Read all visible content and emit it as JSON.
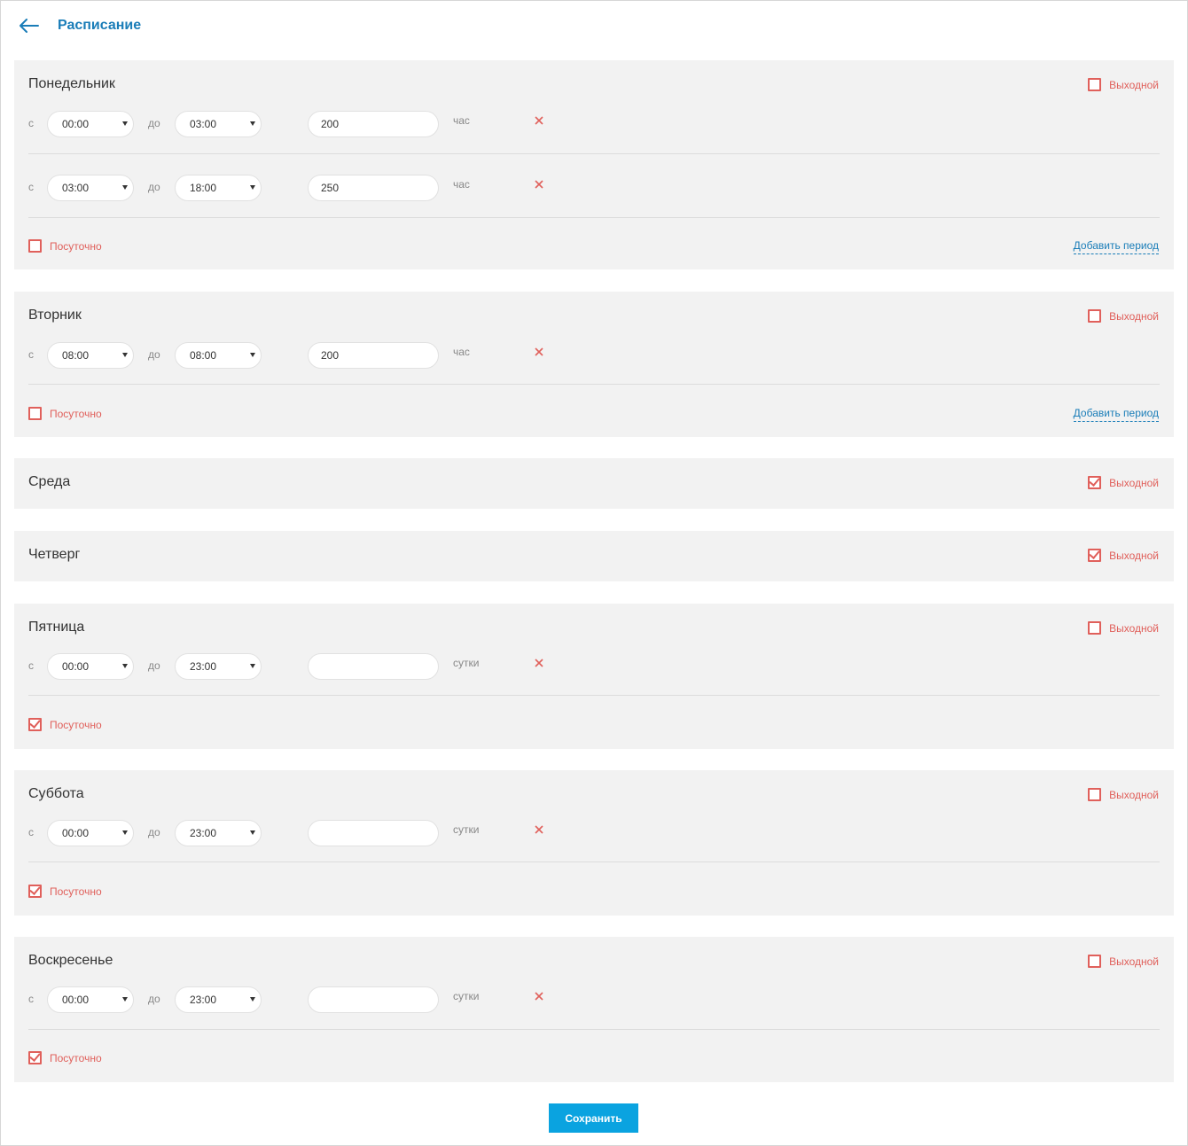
{
  "header": {
    "title": "Расписание"
  },
  "labels": {
    "from": "с",
    "to": "до",
    "day_off": "Выходной",
    "daily": "Посуточно",
    "add_period": "Добавить период",
    "save": "Сохранить"
  },
  "colors": {
    "accent_blue": "#1a7db8",
    "checkbox_red": "#e0605b",
    "button_blue": "#0aa3e0",
    "panel_bg": "#f2f2f2"
  },
  "days": [
    {
      "name": "Понедельник",
      "day_off": false,
      "daily": false,
      "periods": [
        {
          "from": "00:00",
          "to": "03:00",
          "price": "200",
          "unit": "час"
        },
        {
          "from": "03:00",
          "to": "18:00",
          "price": "250",
          "unit": "час"
        }
      ]
    },
    {
      "name": "Вторник",
      "day_off": false,
      "daily": false,
      "periods": [
        {
          "from": "08:00",
          "to": "08:00",
          "price": "200",
          "unit": "час"
        }
      ]
    },
    {
      "name": "Среда",
      "day_off": true,
      "periods": []
    },
    {
      "name": "Четверг",
      "day_off": true,
      "periods": []
    },
    {
      "name": "Пятница",
      "day_off": false,
      "daily": true,
      "periods": [
        {
          "from": "00:00",
          "to": "23:00",
          "price": "",
          "unit": "сутки"
        }
      ]
    },
    {
      "name": "Суббота",
      "day_off": false,
      "daily": true,
      "periods": [
        {
          "from": "00:00",
          "to": "23:00",
          "price": "",
          "unit": "сутки"
        }
      ]
    },
    {
      "name": "Воскресенье",
      "day_off": false,
      "daily": true,
      "periods": [
        {
          "from": "00:00",
          "to": "23:00",
          "price": "",
          "unit": "сутки"
        }
      ]
    }
  ]
}
